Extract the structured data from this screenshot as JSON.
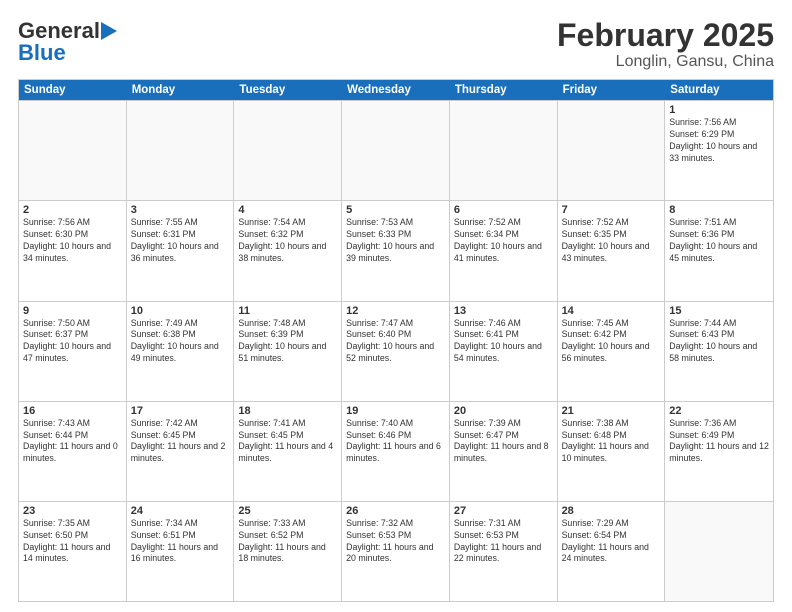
{
  "header": {
    "logo_general": "General",
    "logo_blue": "Blue",
    "title": "February 2025",
    "subtitle": "Longlin, Gansu, China"
  },
  "calendar": {
    "weekdays": [
      "Sunday",
      "Monday",
      "Tuesday",
      "Wednesday",
      "Thursday",
      "Friday",
      "Saturday"
    ],
    "weeks": [
      [
        {
          "day": "",
          "empty": true
        },
        {
          "day": "",
          "empty": true
        },
        {
          "day": "",
          "empty": true
        },
        {
          "day": "",
          "empty": true
        },
        {
          "day": "",
          "empty": true
        },
        {
          "day": "",
          "empty": true
        },
        {
          "day": "1",
          "sunrise": "Sunrise: 7:56 AM",
          "sunset": "Sunset: 6:29 PM",
          "daylight": "Daylight: 10 hours and 33 minutes."
        }
      ],
      [
        {
          "day": "2",
          "sunrise": "Sunrise: 7:56 AM",
          "sunset": "Sunset: 6:30 PM",
          "daylight": "Daylight: 10 hours and 34 minutes."
        },
        {
          "day": "3",
          "sunrise": "Sunrise: 7:55 AM",
          "sunset": "Sunset: 6:31 PM",
          "daylight": "Daylight: 10 hours and 36 minutes."
        },
        {
          "day": "4",
          "sunrise": "Sunrise: 7:54 AM",
          "sunset": "Sunset: 6:32 PM",
          "daylight": "Daylight: 10 hours and 38 minutes."
        },
        {
          "day": "5",
          "sunrise": "Sunrise: 7:53 AM",
          "sunset": "Sunset: 6:33 PM",
          "daylight": "Daylight: 10 hours and 39 minutes."
        },
        {
          "day": "6",
          "sunrise": "Sunrise: 7:52 AM",
          "sunset": "Sunset: 6:34 PM",
          "daylight": "Daylight: 10 hours and 41 minutes."
        },
        {
          "day": "7",
          "sunrise": "Sunrise: 7:52 AM",
          "sunset": "Sunset: 6:35 PM",
          "daylight": "Daylight: 10 hours and 43 minutes."
        },
        {
          "day": "8",
          "sunrise": "Sunrise: 7:51 AM",
          "sunset": "Sunset: 6:36 PM",
          "daylight": "Daylight: 10 hours and 45 minutes."
        }
      ],
      [
        {
          "day": "9",
          "sunrise": "Sunrise: 7:50 AM",
          "sunset": "Sunset: 6:37 PM",
          "daylight": "Daylight: 10 hours and 47 minutes."
        },
        {
          "day": "10",
          "sunrise": "Sunrise: 7:49 AM",
          "sunset": "Sunset: 6:38 PM",
          "daylight": "Daylight: 10 hours and 49 minutes."
        },
        {
          "day": "11",
          "sunrise": "Sunrise: 7:48 AM",
          "sunset": "Sunset: 6:39 PM",
          "daylight": "Daylight: 10 hours and 51 minutes."
        },
        {
          "day": "12",
          "sunrise": "Sunrise: 7:47 AM",
          "sunset": "Sunset: 6:40 PM",
          "daylight": "Daylight: 10 hours and 52 minutes."
        },
        {
          "day": "13",
          "sunrise": "Sunrise: 7:46 AM",
          "sunset": "Sunset: 6:41 PM",
          "daylight": "Daylight: 10 hours and 54 minutes."
        },
        {
          "day": "14",
          "sunrise": "Sunrise: 7:45 AM",
          "sunset": "Sunset: 6:42 PM",
          "daylight": "Daylight: 10 hours and 56 minutes."
        },
        {
          "day": "15",
          "sunrise": "Sunrise: 7:44 AM",
          "sunset": "Sunset: 6:43 PM",
          "daylight": "Daylight: 10 hours and 58 minutes."
        }
      ],
      [
        {
          "day": "16",
          "sunrise": "Sunrise: 7:43 AM",
          "sunset": "Sunset: 6:44 PM",
          "daylight": "Daylight: 11 hours and 0 minutes."
        },
        {
          "day": "17",
          "sunrise": "Sunrise: 7:42 AM",
          "sunset": "Sunset: 6:45 PM",
          "daylight": "Daylight: 11 hours and 2 minutes."
        },
        {
          "day": "18",
          "sunrise": "Sunrise: 7:41 AM",
          "sunset": "Sunset: 6:45 PM",
          "daylight": "Daylight: 11 hours and 4 minutes."
        },
        {
          "day": "19",
          "sunrise": "Sunrise: 7:40 AM",
          "sunset": "Sunset: 6:46 PM",
          "daylight": "Daylight: 11 hours and 6 minutes."
        },
        {
          "day": "20",
          "sunrise": "Sunrise: 7:39 AM",
          "sunset": "Sunset: 6:47 PM",
          "daylight": "Daylight: 11 hours and 8 minutes."
        },
        {
          "day": "21",
          "sunrise": "Sunrise: 7:38 AM",
          "sunset": "Sunset: 6:48 PM",
          "daylight": "Daylight: 11 hours and 10 minutes."
        },
        {
          "day": "22",
          "sunrise": "Sunrise: 7:36 AM",
          "sunset": "Sunset: 6:49 PM",
          "daylight": "Daylight: 11 hours and 12 minutes."
        }
      ],
      [
        {
          "day": "23",
          "sunrise": "Sunrise: 7:35 AM",
          "sunset": "Sunset: 6:50 PM",
          "daylight": "Daylight: 11 hours and 14 minutes."
        },
        {
          "day": "24",
          "sunrise": "Sunrise: 7:34 AM",
          "sunset": "Sunset: 6:51 PM",
          "daylight": "Daylight: 11 hours and 16 minutes."
        },
        {
          "day": "25",
          "sunrise": "Sunrise: 7:33 AM",
          "sunset": "Sunset: 6:52 PM",
          "daylight": "Daylight: 11 hours and 18 minutes."
        },
        {
          "day": "26",
          "sunrise": "Sunrise: 7:32 AM",
          "sunset": "Sunset: 6:53 PM",
          "daylight": "Daylight: 11 hours and 20 minutes."
        },
        {
          "day": "27",
          "sunrise": "Sunrise: 7:31 AM",
          "sunset": "Sunset: 6:53 PM",
          "daylight": "Daylight: 11 hours and 22 minutes."
        },
        {
          "day": "28",
          "sunrise": "Sunrise: 7:29 AM",
          "sunset": "Sunset: 6:54 PM",
          "daylight": "Daylight: 11 hours and 24 minutes."
        },
        {
          "day": "",
          "empty": true
        }
      ]
    ]
  }
}
